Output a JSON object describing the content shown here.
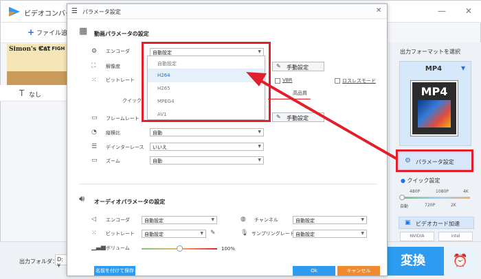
{
  "app": {
    "title": "ビデオコンバー",
    "add_file": "ファイル追",
    "thumbnail_text_1": "Simon's Cat",
    "thumbnail_text_2": "'CAT FIGH",
    "subtitle_none": "なし",
    "output_folder_label": "出力フォルダ：",
    "output_folder_value": "D:¥",
    "convert_button": "変換"
  },
  "right_panel": {
    "output_format_title": "出力フォーマットを選択",
    "format_name": "MP4",
    "format_icon_label": "MP4",
    "param_button": "パラメータ設定",
    "quick_setting": "クイック設定",
    "quick_marks_top": [
      "480P",
      "1080P",
      "4K"
    ],
    "quick_marks_bottom": [
      "自動",
      "720P",
      "2K"
    ],
    "video_accel": "ビデオカード加速",
    "vendor_nvidia": "NVIDIA",
    "vendor_intel": "intel"
  },
  "dialog": {
    "title": "パラメータ設定",
    "video_section_title": "動画パラメータの設定",
    "video_rows": {
      "encoder_label": "エンコーダ",
      "encoder_value": "自動設定",
      "resolution_label": "解像度",
      "bitrate_label": "ビットレート",
      "quick_label": "クイック",
      "quality_high": "高品質",
      "framerate_label": "フレームレート",
      "framerate_value": "自動設定",
      "aspect_label": "縦横比",
      "aspect_value": "自動",
      "deinterlace_label": "デインターレース",
      "deinterlace_value": "いいえ",
      "zoom_label": "ズーム",
      "zoom_value": "自動",
      "manual_button_1": "手動設定",
      "manual_button_2": "手動設定",
      "vbr_label": "VBR",
      "lossless_label": "ロスレスモード"
    },
    "encoder_dropdown": [
      "自動設定",
      "H264",
      "H265",
      "MPEG4",
      "AV1"
    ],
    "encoder_dropdown_selected": "H264",
    "audio_section_title": "オーディオパラメータの設定",
    "audio_rows": {
      "encoder_label": "エンコーダ",
      "encoder_value": "自動設定",
      "bitrate_label": "ビットレート",
      "bitrate_value": "自動設定",
      "volume_label": "ボリューム",
      "volume_value": "100%",
      "volume_level": 0.5,
      "channel_label": "チャンネル",
      "channel_value": "自動設定",
      "samplerate_label": "サンプリングレート",
      "samplerate_value": "自動設定"
    },
    "save_name_button": "名前を付けて保存",
    "ok_button": "Ok",
    "cancel_button": "キャンセル"
  },
  "colors": {
    "accent_blue": "#2d9cf0",
    "highlight_red": "#e0202a",
    "cancel_orange": "#f08a2e"
  }
}
